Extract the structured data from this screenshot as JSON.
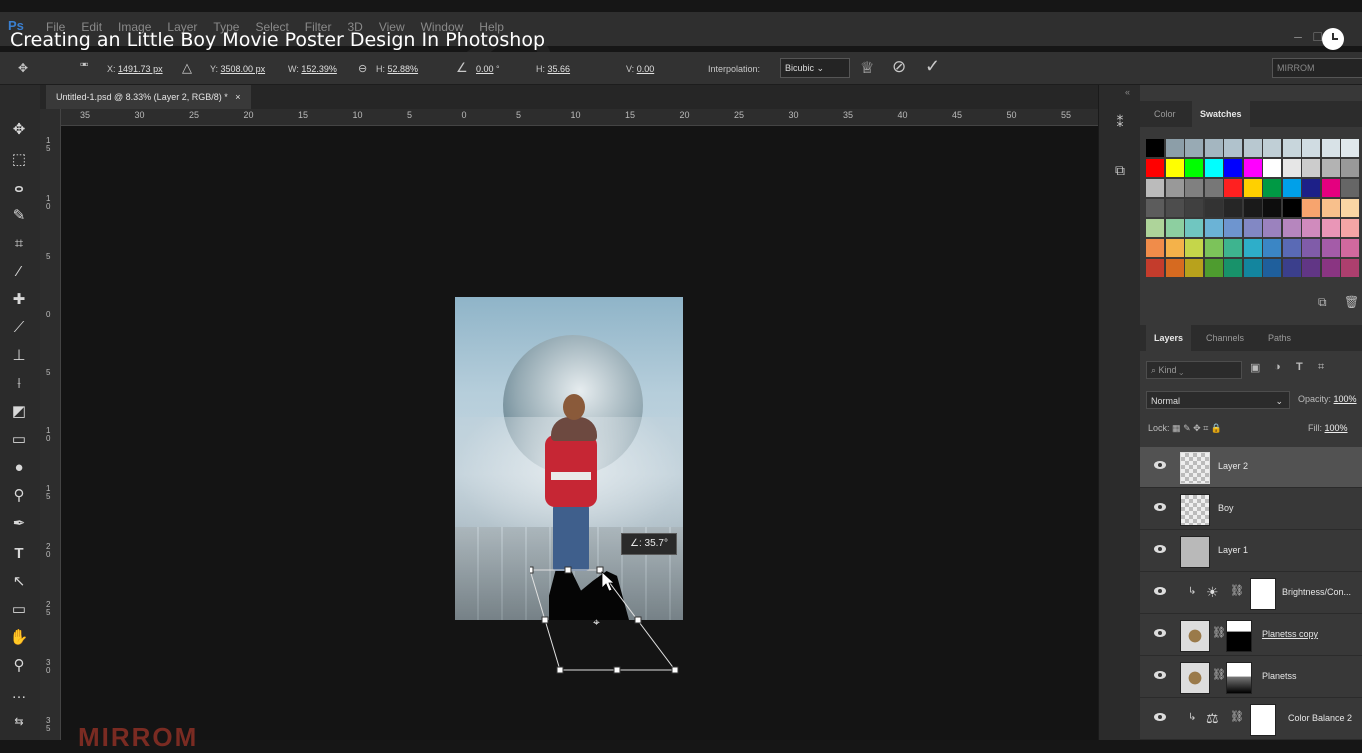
{
  "video_title": "Creating an Little Boy Movie Poster Design In Photoshop",
  "menu": [
    "Ps",
    "File",
    "Edit",
    "Image",
    "Layer",
    "Type",
    "Select",
    "Filter",
    "3D",
    "View",
    "Window",
    "Help"
  ],
  "window_controls": [
    "–",
    "□"
  ],
  "options": {
    "x_label": "X:",
    "x_value": "1491.73 px",
    "y_label": "Y:",
    "y_value": "3508.00 px",
    "w_label": "W:",
    "w_value": "152.39%",
    "h_label": "H:",
    "h_value": "52.88%",
    "angle_value": "0.00",
    "angle_unit": "°",
    "hskew_label": "H:",
    "hskew_value": "35.66",
    "vskew_label": "V:",
    "vskew_value": "0.00",
    "interp_label": "Interpolation:",
    "interp_value": "Bicubic",
    "workspace": "MIRROM",
    "commit_icon": "check-icon",
    "cancel_icon": "cancel-icon"
  },
  "document_tab": {
    "title": "Untitled-1.psd @ 8.33% (Layer 2, RGB/8) *",
    "close": "×"
  },
  "ruler_h": [
    "35",
    "30",
    "25",
    "20",
    "15",
    "10",
    "5",
    "0",
    "5",
    "10",
    "15",
    "20",
    "25",
    "30",
    "35",
    "40",
    "45",
    "50",
    "55"
  ],
  "ruler_v": [
    "1 5",
    "1 0",
    "5",
    "0",
    "5",
    "1 0",
    "1 5",
    "2 0",
    "2 5",
    "3 0",
    "3 5"
  ],
  "transform_tooltip": "∠: 35.7°",
  "corner_logo": "MIRROM",
  "swatches_panel": {
    "tabs": [
      "Color",
      "Swatches"
    ],
    "active": "Swatches"
  },
  "swatch_colors": [
    "#000000",
    "#8c9ea8",
    "#98aab4",
    "#a4b6c0",
    "#b0c2cc",
    "#b8c8d0",
    "#c0cfd6",
    "#c8d6dc",
    "#d0dce2",
    "#d8e2e7",
    "#e0e8ec",
    "#ff0000",
    "#ffff00",
    "#00ff00",
    "#00ffff",
    "#0000ff",
    "#ff00ff",
    "#ffffff",
    "#e6e6e6",
    "#cccccc",
    "#b3b3b3",
    "#999999",
    "#bbbbbb",
    "#999999",
    "#808080",
    "#777777",
    "#ff2020",
    "#ffd000",
    "#009944",
    "#00a0e9",
    "#1d2088",
    "#e4007f",
    "#666666",
    "#5c5c5c",
    "#4d4d4d",
    "#404040",
    "#333333",
    "#262626",
    "#1a1a1a",
    "#0d0d0d",
    "#000000",
    "#f7a46e",
    "#f8c08c",
    "#f9d6a4",
    "#aed49a",
    "#8dcfa0",
    "#70c6c0",
    "#6bb3d6",
    "#6e95cf",
    "#8288c4",
    "#9b82be",
    "#b686be",
    "#d08bbd",
    "#e996b7",
    "#f4a6a6",
    "#f08c4a",
    "#f4b24a",
    "#c5d64a",
    "#7cc35a",
    "#3eb48f",
    "#2eaec9",
    "#3b86c5",
    "#5a6ab5",
    "#805ca9",
    "#a45ca8",
    "#d0699e",
    "#c43c2c",
    "#d66a20",
    "#b8a21c",
    "#4e9c2f",
    "#18926a",
    "#13859e",
    "#1f5f9c",
    "#3b3f8c",
    "#613685",
    "#8a3582",
    "#ad3f6e"
  ],
  "layers_panel": {
    "tabs": [
      "Layers",
      "Channels",
      "Paths"
    ],
    "kind_placeholder": "Kind",
    "blend_mode": "Normal",
    "opacity_label": "Opacity:",
    "opacity_value": "100%",
    "lock_label": "Lock:",
    "fill_label": "Fill:",
    "fill_value": "100%"
  },
  "layers": [
    {
      "name": "Layer 2",
      "selected": true
    },
    {
      "name": "Boy",
      "selected": false
    },
    {
      "name": "Layer 1",
      "selected": false
    },
    {
      "name": "Brightness/Con...",
      "selected": false
    },
    {
      "name": "Planetss copy",
      "selected": false
    },
    {
      "name": "Planetss",
      "selected": false
    },
    {
      "name": "Color Balance 2",
      "selected": false
    }
  ]
}
